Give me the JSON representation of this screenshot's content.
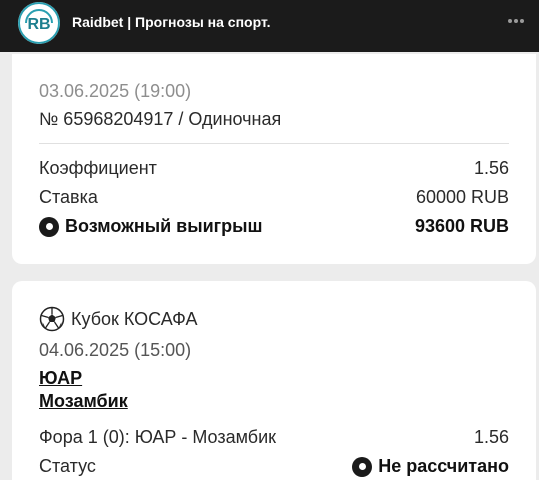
{
  "header": {
    "app_title": "Raidbet | Прогнозы на спорт.",
    "logo_text": "RB"
  },
  "bet": {
    "date": "03.06.2025 (19:00)",
    "number_line": "№ 65968204917 / Одиночная",
    "coef_label": "Коэффициент",
    "coef_value": "1.56",
    "stake_label": "Ставка",
    "stake_value": "60000 RUB",
    "win_label": "Возможный выигрыш",
    "win_value": "93600 RUB"
  },
  "event": {
    "competition": "Кубок КОСАФА",
    "date": "04.06.2025 (15:00)",
    "team1": "ЮАР",
    "team2": "Мозамбик",
    "market_label": "Фора 1 (0): ЮАР - Мозамбик",
    "market_value": "1.56",
    "status_label": "Статус",
    "status_value": "Не рассчитано"
  },
  "colors": {
    "topbar": "#1b1b1b",
    "background": "#ececec",
    "card": "#ffffff",
    "logo_accent": "#2a9fb1"
  },
  "icons": {
    "logo": "raidbet-logo-icon",
    "more": "more-dots-icon",
    "win": "radio-dot-icon",
    "competition": "soccer-ball-icon",
    "status": "radio-dot-icon"
  }
}
